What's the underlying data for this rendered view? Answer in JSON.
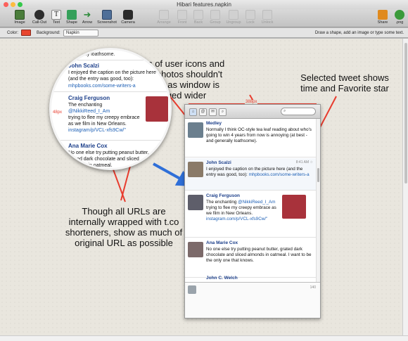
{
  "window": {
    "title": "Hibari features.napkin"
  },
  "toolbar": {
    "items": [
      {
        "label": "Image",
        "icon": "image-icon",
        "color": "#4b7d3b",
        "enabled": true
      },
      {
        "label": "Call-Out",
        "icon": "callout-icon",
        "color": "#2d2d2d",
        "enabled": true
      },
      {
        "label": "Text",
        "icon": "text-icon",
        "color": "#f2f2f2",
        "enabled": true
      },
      {
        "label": "Shape",
        "icon": "shape-icon",
        "color": "#35a05a",
        "enabled": true
      },
      {
        "label": "Arrow",
        "icon": "arrow-icon",
        "color": "#2f8c3c",
        "enabled": true
      },
      {
        "label": "Screenshot",
        "icon": "screenshot-icon",
        "color": "#4f6f98",
        "enabled": true
      },
      {
        "label": "Camera",
        "icon": "camera-icon",
        "color": "#2a2a2a",
        "enabled": true
      },
      {
        "label": "Arrange",
        "icon": "arrange-icon",
        "enabled": false
      },
      {
        "label": "Front",
        "icon": "front-icon",
        "enabled": false
      },
      {
        "label": "Back",
        "icon": "back-icon",
        "enabled": false
      },
      {
        "label": "Group",
        "icon": "group-icon",
        "enabled": false
      },
      {
        "label": "Ungroup",
        "icon": "ungroup-icon",
        "enabled": false
      },
      {
        "label": "Lock",
        "icon": "lock-icon",
        "enabled": false
      },
      {
        "label": "Unlock",
        "icon": "unlock-icon",
        "enabled": false
      }
    ],
    "right_items": [
      {
        "label": "Share",
        "icon": "share-icon",
        "color": "#e08a1e"
      },
      {
        "label": ".png",
        "icon": "export-png-icon",
        "color": "#3a9a3a"
      }
    ]
  },
  "options": {
    "color_label": "Color:",
    "color_value": "#e8452e",
    "background_label": "Background:",
    "background_value": "Napkin",
    "hint": "Draw a shape, add an image or type some text."
  },
  "annotations": {
    "top_center": "Sizes of user icons and inline photos shouldn't change as window is dragged wider",
    "top_right": "Selected tweet shows time and Favorite star",
    "bottom_left": "Though all URLs are internally wrapped with t.co shorteners, show as much of original URL as possible",
    "width_marker": "388px",
    "width_marker_small": "48px"
  },
  "magnifier": {
    "snippet_top": "e generally loathsome.",
    "tweets": [
      {
        "name": "John Scalzi",
        "text": "I enjoyed the caption on the picture here (and the entry was good, too):",
        "url": "mhpbooks.com/some-writers-a"
      },
      {
        "name": "Craig Ferguson",
        "text": "The enchanting",
        "mention": "@NikkiReed_I_Am",
        "text2": "trying to flee my creepy embrace as we film in New Orleans.",
        "url": "instagram/p/VCL-xfs9Cw/\""
      },
      {
        "name": "Ana Marie Cox",
        "text": "No one else try putting peanut butter, grated dark chocolate and sliced almonds in oatmeal."
      }
    ]
  },
  "app": {
    "search_placeholder": "",
    "tweets": [
      {
        "name": "Medley",
        "text": "Normally I think OC-style tea leaf reading about who's going to win 4 years from now is annoying (at best - and generally loathsome).",
        "time": "",
        "avatar_color": "#6b7f8e"
      },
      {
        "name": "John Scalzi",
        "time": "8:41 AM",
        "text": "I enjoyed the caption on the picture here (and the entry was good, too):",
        "url": "mhpbooks.com/some-writers-a",
        "avatar_color": "#8a7a68"
      },
      {
        "name": "Craig Ferguson",
        "text": "The enchanting",
        "mention": "@NikkiReed_I_Am",
        "text2": "trying to flee my creepy embrace as we film in New Orleans.",
        "url": "instagram.com/p/VCL-xfs9Cw/\"",
        "avatar_color": "#5e5e6a",
        "photo_color": "#a8323b"
      },
      {
        "name": "Ana Marie Cox",
        "text": "No one else try putting peanut butter, grated dark chocolate and sliced almonds in oatmeal. I want to be the only one that knows.",
        "avatar_color": "#7c6a6a"
      },
      {
        "name": "John C. Welch",
        "text": "",
        "avatar_color": "#9aa3ab"
      }
    ],
    "char_count": "140"
  }
}
